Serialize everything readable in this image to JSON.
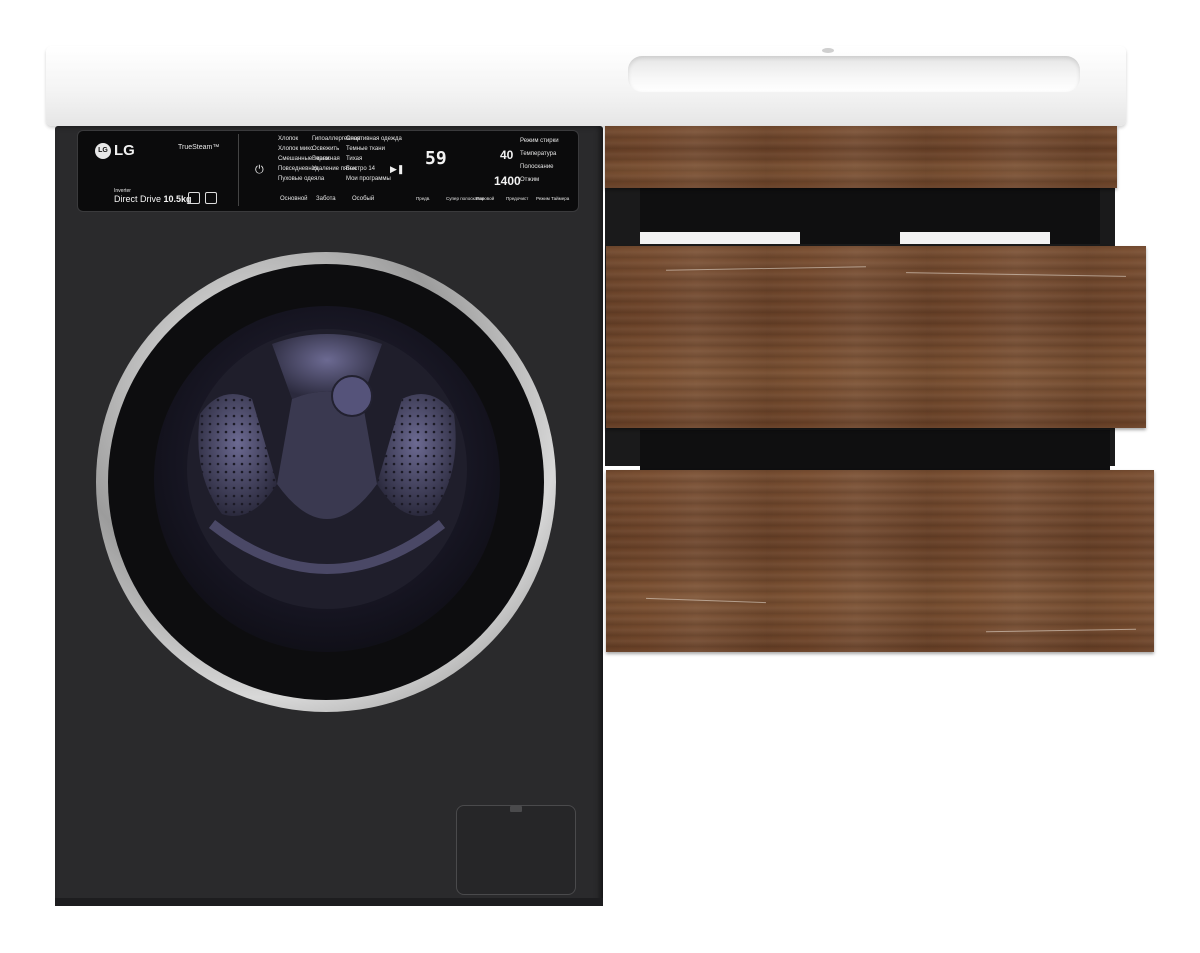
{
  "washer": {
    "brand": "LG",
    "brand_mark": "LG",
    "feature_badge": "TrueSteam™",
    "inverter_label": "Inverter",
    "motor_label": "Direct Drive",
    "capacity": "10.5kg",
    "display_time": "59",
    "display_temp": "40",
    "display_spin": "1400",
    "programs": [
      "Хлопок",
      "Хлопок микс",
      "Смешанные ткани",
      "Повседневная",
      "Пуховые одеяла",
      "Гипоаллергенная",
      "Освежить",
      "Бережная",
      "Удаление пятен",
      "Спортивная одежда",
      "Темные ткани",
      "Тихая",
      "Быстро 14",
      "Мои программы"
    ],
    "program_groups": [
      "Основной",
      "Забота",
      "Особый"
    ],
    "option_buttons": [
      "Предв.",
      "Супер полоскание",
      "Паровой",
      "Предочист",
      "Режим Таймера"
    ],
    "setting_labels": [
      "Режим стирки",
      "Температура",
      "Полоскание",
      "Отжим"
    ]
  },
  "colors": {
    "washer_body": "#2a2a2c",
    "countertop": "#f4f4f4",
    "wood": "#6b4228",
    "chrome": "#c8c8c8"
  }
}
